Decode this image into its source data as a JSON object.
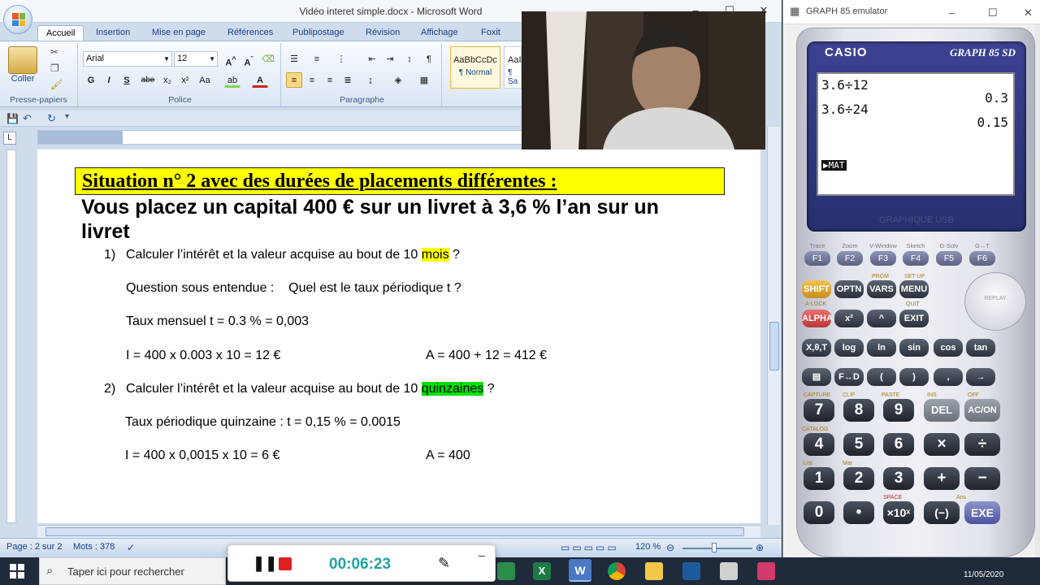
{
  "word": {
    "title": "Vidéo interet simple.docx - Microsoft Word",
    "window_controls": [
      "–",
      "☐",
      "✕"
    ],
    "tabs": [
      "Accueil",
      "Insertion",
      "Mise en page",
      "Références",
      "Publipostage",
      "Révision",
      "Affichage",
      "Foxit PDF"
    ],
    "active_tab": "Accueil",
    "ribbon": {
      "clipboard_label": "Presse-papiers",
      "paste_label": "Coller",
      "font_label": "Police",
      "font_name": "Arial",
      "font_size": "12",
      "format_buttons": [
        "G",
        "I",
        "S",
        "abe",
        "x₂",
        "x²",
        "Aa"
      ],
      "paragraph_label": "Paragraphe",
      "style_sample": "AaBbCcDc",
      "style_name": "¶ Normal",
      "style_sample_2": "AaI",
      "style_name_2": "¶ Sa"
    },
    "status": {
      "page": "Page : 2 sur 2",
      "words": "Mots : 378",
      "zoom": "120 %"
    },
    "document": {
      "heading": "Situation n° 2 avec des durées de placements différentes :",
      "intro_line1": "Vous placez un capital  400 € sur un livret à 3,6 % l’an sur un",
      "intro_line2": "livret",
      "q1_num": "1)",
      "q1_text": "Calculer l’intérêt et la valeur acquise au bout de 10 ",
      "q1_highlight": "mois",
      "q1_end": " ?",
      "q1_sub": "Question sous entendue :    Quel est le taux périodique t ?",
      "q1_rate": "Taux mensuel t = 0.3 % = 0,003",
      "q1_interest": "I = 400 x 0.003 x 10 = 12 €",
      "q1_acquired": "A = 400 + 12 = 412 €",
      "q2_num": "2)",
      "q2_text": "Calculer l’intérêt et la valeur acquise au bout de 10 ",
      "q2_highlight": "quinzaines",
      "q2_end": " ?",
      "q2_rate": "Taux périodique quinzaine : t = 0,15 % = 0.0015",
      "q2_interest": "I = 400 x 0,0015 x 10 = 6 €",
      "q2_acquired": "A = 400"
    }
  },
  "calculator": {
    "window_title": "GRAPH 85 emulator",
    "brand": "CASIO",
    "model": "GRAPH 85 SD",
    "usb_label": "GRAPHIQUE USB",
    "screen": {
      "line1_expr": "3.6÷12",
      "line1_result": "0.3",
      "line2_expr": "3.6÷24",
      "line2_result": "0.15",
      "menu_tag": "▶MAT"
    },
    "f_labels": [
      "Trace",
      "Zoom",
      "V-Window",
      "Sketch",
      "G-Solv",
      "G↔T"
    ],
    "f_keys": [
      "F1",
      "F2",
      "F3",
      "F4",
      "F5",
      "F6"
    ],
    "row1": [
      "SHIFT",
      "OPTN",
      "VARS",
      "MENU"
    ],
    "row2": [
      "ALPHA",
      "x²",
      "^",
      "EXIT"
    ],
    "row3": [
      "X,θ,T",
      "log",
      "ln",
      "sin",
      "cos",
      "tan"
    ],
    "row4": [
      "▤",
      "F↔D",
      "(",
      ")",
      ",",
      "→"
    ],
    "replay_label": "REPLAY",
    "num_rows": [
      [
        "7",
        "8",
        "9",
        "DEL",
        "AC/ON"
      ],
      [
        "4",
        "5",
        "6",
        "×",
        "÷"
      ],
      [
        "1",
        "2",
        "3",
        "+",
        "−"
      ],
      [
        "0",
        "•",
        "×10ˣ",
        "(−)",
        "EXE"
      ]
    ],
    "secondary_labels": {
      "prgm": "PRGM",
      "setup": "SET UP",
      "alock": "A-LOCK",
      "quit": "QUIT",
      "capture": "CAPTURE",
      "clip": "CLIP",
      "paste": "PASTE",
      "ins": "INS",
      "off": "OFF",
      "catalog": "CATALOG",
      "list": "List",
      "mat": "Mat",
      "space": "SPACE",
      "ans": "Ans"
    }
  },
  "taskbar": {
    "search_placeholder": "Taper ici pour rechercher",
    "recorder_time": "00:06:23",
    "date": "11/05/2020"
  },
  "colors": {
    "highlight_yellow": "#ffff00",
    "highlight_green": "#00e000",
    "ribbon_blue": "#15428b",
    "recorder_time": "#1fa3a3",
    "record_red": "#e02020"
  }
}
